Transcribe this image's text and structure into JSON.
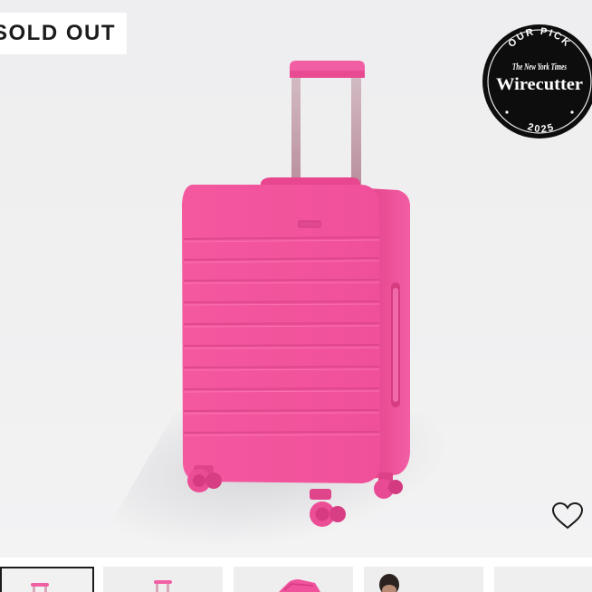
{
  "product": {
    "status_badge": "SOLD OUT",
    "color_name": "pink",
    "image_icon": "pink-carry-on-suitcase",
    "accent_color": "#f0529c"
  },
  "award_badge": {
    "top_text": "OUR PICK",
    "publisher": "The New York Times",
    "name": "Wirecutter",
    "year": "2025",
    "background": "#0d0d0d"
  },
  "wishlist": {
    "icon": "heart-outline-icon"
  },
  "thumbnails": [
    {
      "name": "thumb-front",
      "active": true
    },
    {
      "name": "thumb-side",
      "active": false
    },
    {
      "name": "thumb-top",
      "active": false
    },
    {
      "name": "thumb-person",
      "active": false
    },
    {
      "name": "thumb-detail",
      "active": false
    }
  ]
}
